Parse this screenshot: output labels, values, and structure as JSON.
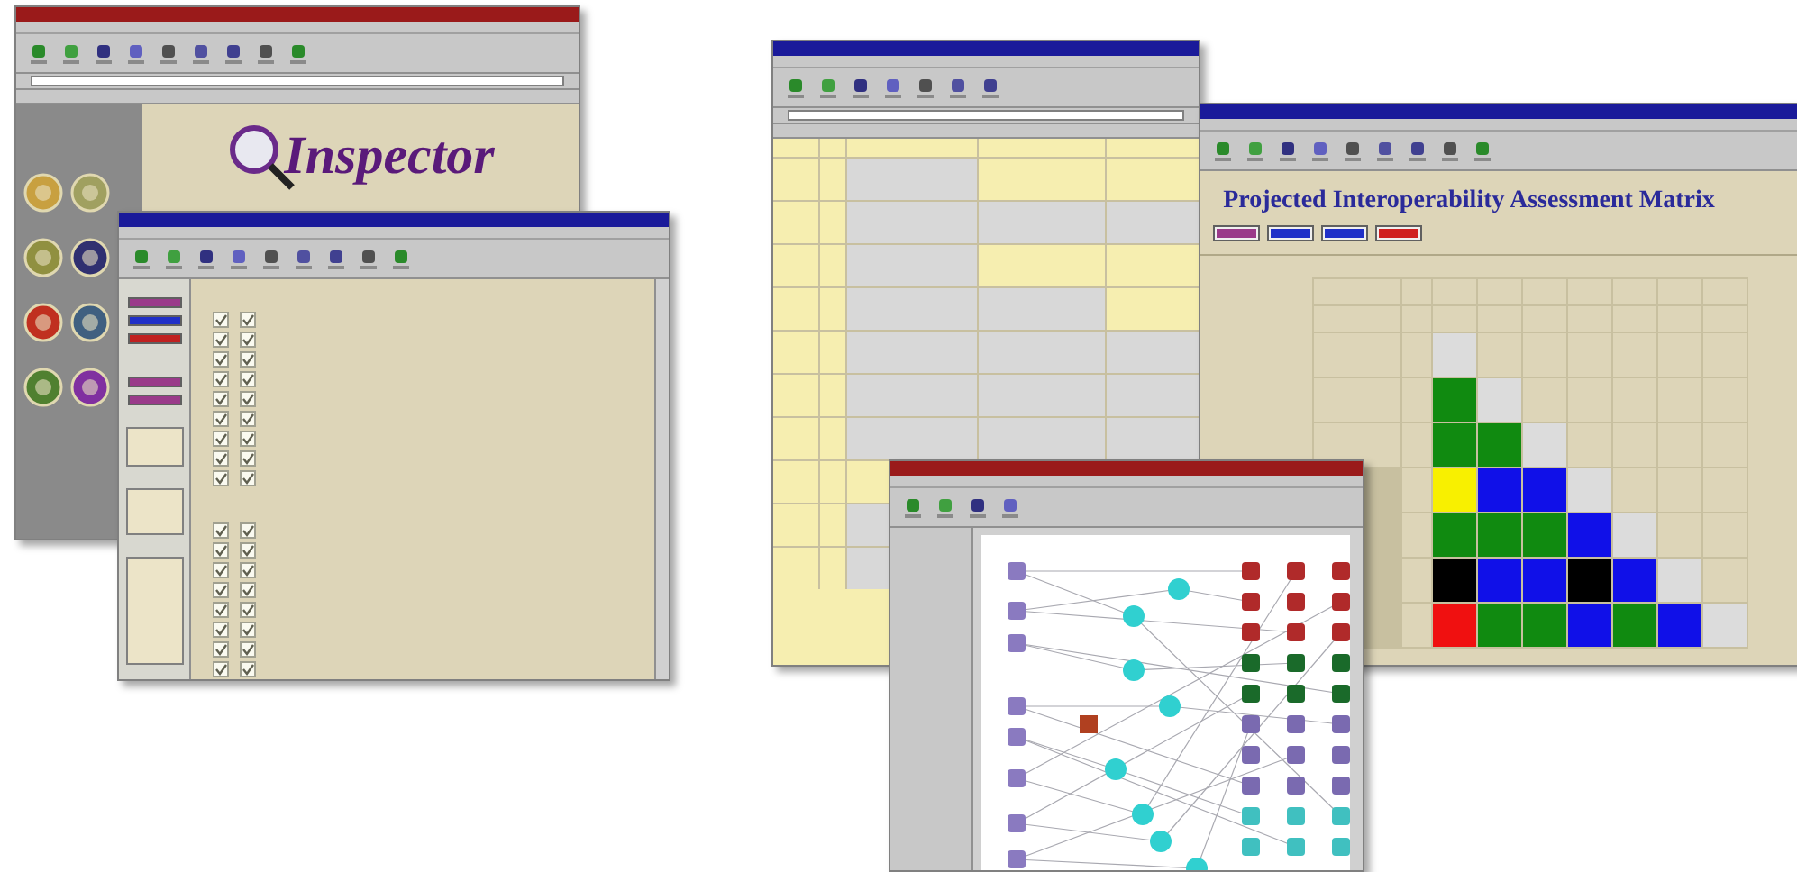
{
  "inspector_window": {
    "logo": "Inspector",
    "emblems": [
      {
        "color": "#c8a040"
      },
      {
        "color": "#a0a060"
      },
      {
        "color": "#909040"
      },
      {
        "color": "#303070"
      },
      {
        "color": "#c03020"
      },
      {
        "color": "#406080"
      },
      {
        "color": "#508030"
      },
      {
        "color": "#8030a0"
      }
    ]
  },
  "survey_window": {
    "rows": [
      {
        "first_checked": true,
        "second_checked": true
      },
      {
        "first_checked": true,
        "second_checked": true
      },
      {
        "first_checked": true,
        "second_checked": true
      },
      {
        "first_checked": true,
        "second_checked": true
      },
      {
        "first_checked": true,
        "second_checked": true
      },
      {
        "first_checked": true,
        "second_checked": true
      },
      {
        "first_checked": true,
        "second_checked": true
      },
      {
        "first_checked": true,
        "second_checked": true
      },
      {
        "first_checked": true,
        "second_checked": true
      }
    ],
    "rows_lower": [
      {
        "first_checked": true,
        "second_checked": true
      },
      {
        "first_checked": true,
        "second_checked": true
      },
      {
        "first_checked": true,
        "second_checked": true
      },
      {
        "first_checked": true,
        "second_checked": true
      },
      {
        "first_checked": true,
        "second_checked": true
      },
      {
        "first_checked": true,
        "second_checked": true
      },
      {
        "first_checked": true,
        "second_checked": true
      },
      {
        "first_checked": true,
        "second_checked": true
      }
    ]
  },
  "table_window": {
    "rows": [
      {
        "cells": [
          {
            "color": "#f6eeb0"
          },
          {
            "color": "#f6eeb0"
          },
          {
            "color": "#d8d8d8"
          },
          {
            "color": "#f6eeb0"
          },
          {
            "color": "#f6eeb0"
          }
        ]
      },
      {
        "cells": [
          {
            "color": "#f6eeb0"
          },
          {
            "color": "#f6eeb0"
          },
          {
            "color": "#d8d8d8"
          },
          {
            "color": "#d8d8d8"
          },
          {
            "color": "#d8d8d8"
          }
        ]
      },
      {
        "cells": [
          {
            "color": "#f6eeb0"
          },
          {
            "color": "#f6eeb0"
          },
          {
            "color": "#d8d8d8"
          },
          {
            "color": "#f6eeb0"
          },
          {
            "color": "#f6eeb0"
          }
        ]
      },
      {
        "cells": [
          {
            "color": "#f6eeb0"
          },
          {
            "color": "#f6eeb0"
          },
          {
            "color": "#d8d8d8"
          },
          {
            "color": "#d8d8d8"
          },
          {
            "color": "#f6eeb0"
          }
        ]
      },
      {
        "cells": [
          {
            "color": "#f6eeb0"
          },
          {
            "color": "#f6eeb0"
          },
          {
            "color": "#d8d8d8"
          },
          {
            "color": "#d8d8d8"
          },
          {
            "color": "#d8d8d8"
          }
        ]
      },
      {
        "cells": [
          {
            "color": "#f6eeb0"
          },
          {
            "color": "#f6eeb0"
          },
          {
            "color": "#d8d8d8"
          },
          {
            "color": "#d8d8d8"
          },
          {
            "color": "#d8d8d8"
          }
        ]
      },
      {
        "cells": [
          {
            "color": "#f6eeb0"
          },
          {
            "color": "#f6eeb0"
          },
          {
            "color": "#d8d8d8"
          },
          {
            "color": "#d8d8d8"
          },
          {
            "color": "#d8d8d8"
          }
        ]
      },
      {
        "cells": [
          {
            "color": "#f6eeb0"
          },
          {
            "color": "#f6eeb0"
          },
          {
            "color": "#f6eeb0"
          }
        ]
      },
      {
        "cells": [
          {
            "color": "#f6eeb0"
          },
          {
            "color": "#f6eeb0"
          },
          {
            "color": "#d8d8d8"
          }
        ]
      },
      {
        "cells": [
          {
            "color": "#f6eeb0"
          },
          {
            "color": "#f6eeb0"
          },
          {
            "color": "#d8d8d8"
          }
        ]
      }
    ]
  },
  "matrix_window": {
    "title": "Projected Interoperability Assessment Matrix",
    "legend": [
      {
        "color": "#9a3a8a"
      },
      {
        "color": "#2030c8"
      },
      {
        "color": "#2030c8"
      },
      {
        "color": "#d02020"
      }
    ],
    "rows": [
      {
        "cells": [
          {
            "color": "#dcdcdc"
          }
        ]
      },
      {
        "cells": [
          {
            "color": "#108a10"
          },
          {
            "color": "#dcdcdc"
          }
        ]
      },
      {
        "cells": [
          {
            "color": "#108a10"
          },
          {
            "color": "#108a10"
          },
          {
            "color": "#dcdcdc"
          }
        ]
      },
      {
        "cells": [
          {
            "color": "#f8f000"
          },
          {
            "color": "#1010e8"
          },
          {
            "color": "#1010e8"
          },
          {
            "color": "#dcdcdc"
          }
        ]
      },
      {
        "cells": [
          {
            "color": "#108a10"
          },
          {
            "color": "#108a10"
          },
          {
            "color": "#108a10"
          },
          {
            "color": "#1010e8"
          },
          {
            "color": "#dcdcdc"
          }
        ]
      },
      {
        "cells": [
          {
            "color": "#000000"
          },
          {
            "color": "#1010e8"
          },
          {
            "color": "#1010e8"
          },
          {
            "color": "#000000"
          },
          {
            "color": "#1010e8"
          },
          {
            "color": "#dcdcdc"
          }
        ]
      },
      {
        "cells": [
          {
            "color": "#f01010"
          },
          {
            "color": "#108a10"
          },
          {
            "color": "#108a10"
          },
          {
            "color": "#1010e8"
          },
          {
            "color": "#108a10"
          },
          {
            "color": "#1010e8"
          },
          {
            "color": "#dcdcdc"
          }
        ]
      }
    ]
  }
}
